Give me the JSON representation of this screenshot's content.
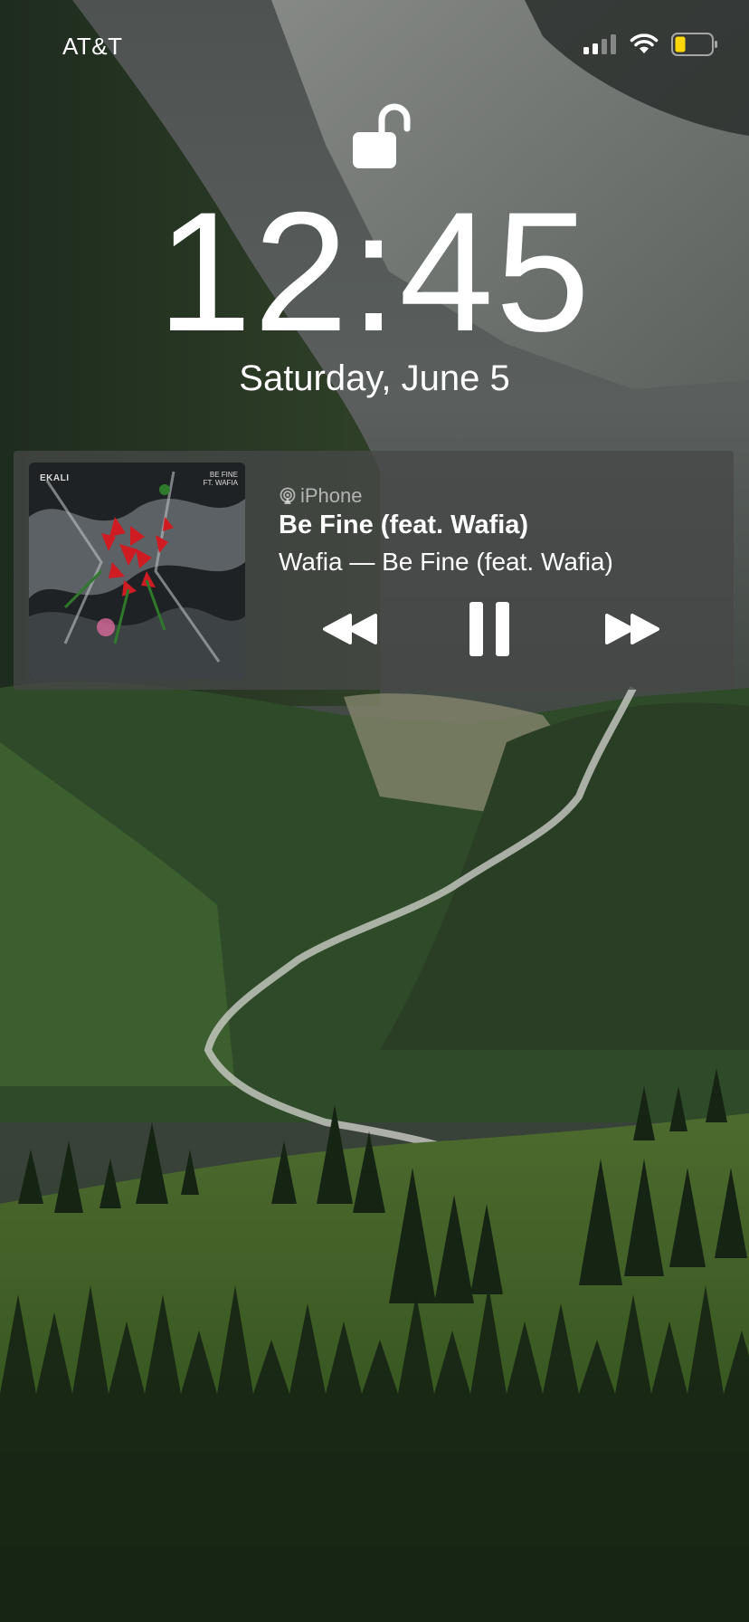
{
  "status_bar": {
    "carrier": "AT&T",
    "signal_bars_active": 2,
    "signal_bars_total": 4,
    "battery_color": "#ffd60a"
  },
  "lock_screen": {
    "time": "12:45",
    "date": "Saturday, June 5"
  },
  "now_playing": {
    "output_device": "iPhone",
    "title": "Be Fine (feat. Wafia)",
    "subtitle": "Wafia — Be Fine (feat. Wafia)",
    "state": "playing",
    "artwork": {
      "top_left": "EKALI",
      "top_right": "BE FINE FT. WAFIA"
    }
  }
}
